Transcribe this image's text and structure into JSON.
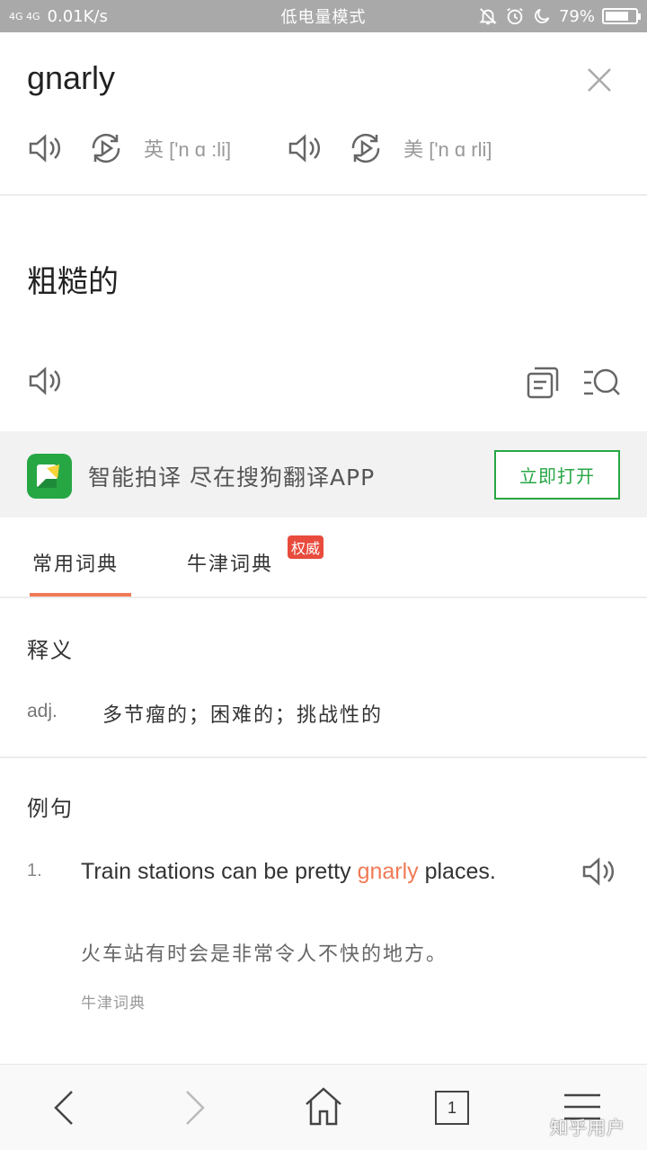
{
  "status_bar": {
    "signal": "4G 4G",
    "speed": "0.01K/s",
    "mode": "低电量模式",
    "battery_percent": "79%",
    "battery_level": 0.79,
    "icons": [
      "mute-bell-icon",
      "alarm-icon",
      "moon-icon",
      "battery-icon"
    ]
  },
  "entry": {
    "word": "gnarly",
    "uk_label": "英 ['n ɑ :li]",
    "us_label": "美 ['n ɑ rli]",
    "translation": "粗糙的"
  },
  "banner": {
    "text": "智能拍译 尽在搜狗翻译APP",
    "button": "立即打开",
    "accent": "#27a744"
  },
  "tabs": {
    "items": [
      {
        "label": "常用词典",
        "active": true
      },
      {
        "label": "牛津词典",
        "active": false
      }
    ],
    "badge": "权威",
    "accent": "#f07a55"
  },
  "definitions": {
    "title": "释义",
    "items": [
      {
        "pos": "adj.",
        "meaning": "多节瘤的；困难的；挑战性的"
      }
    ]
  },
  "examples": {
    "title": "例句",
    "items": [
      {
        "num": "1.",
        "en_before": "Train stations can be pretty ",
        "en_highlight": "gnarly",
        "en_after": " places.",
        "cn": "火车站有时会是非常令人不快的地方。",
        "source": "牛津词典"
      }
    ]
  },
  "bottom_nav": {
    "tab_count": "1",
    "watermark": "知乎用户"
  }
}
